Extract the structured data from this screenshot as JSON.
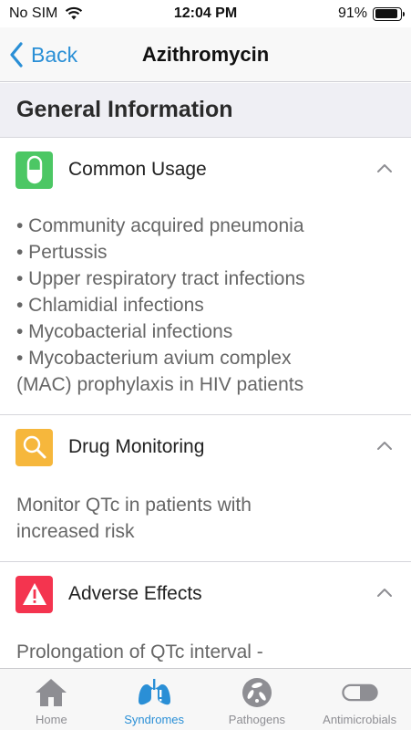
{
  "status_bar": {
    "carrier": "No SIM",
    "time": "12:04 PM",
    "battery": "91%",
    "battery_level": 0.91
  },
  "nav": {
    "back_label": "Back",
    "title": "Azithromycin"
  },
  "section": {
    "title": "General Information"
  },
  "accordions": [
    {
      "label": "Common Usage",
      "icon": "pill-icon",
      "color": "#4cc764",
      "lines": [
        "• Community acquired pneumonia",
        "• Pertussis",
        "• Upper respiratory tract infections",
        "• Chlamidial infections",
        "• Mycobacterial infections",
        "• Mycobacterium avium complex",
        "(MAC) prophylaxis in HIV patients"
      ]
    },
    {
      "label": "Drug Monitoring",
      "icon": "magnifier-icon",
      "color": "#f6b73c",
      "lines": [
        "Monitor QTc in patients with",
        "increased risk"
      ]
    },
    {
      "label": "Adverse Effects",
      "icon": "warning-icon",
      "color": "#f4344f",
      "lines": [
        "Prolongation of QTc interval -"
      ]
    }
  ],
  "tabs": [
    {
      "label": "Home",
      "icon": "house-icon"
    },
    {
      "label": "Syndromes",
      "icon": "lungs-icon",
      "active": true
    },
    {
      "label": "Pathogens",
      "icon": "pathogen-icon"
    },
    {
      "label": "Antimicrobials",
      "icon": "capsule-icon"
    }
  ],
  "colors": {
    "accent": "#2a8fd6",
    "inactive": "#8e8e93"
  }
}
